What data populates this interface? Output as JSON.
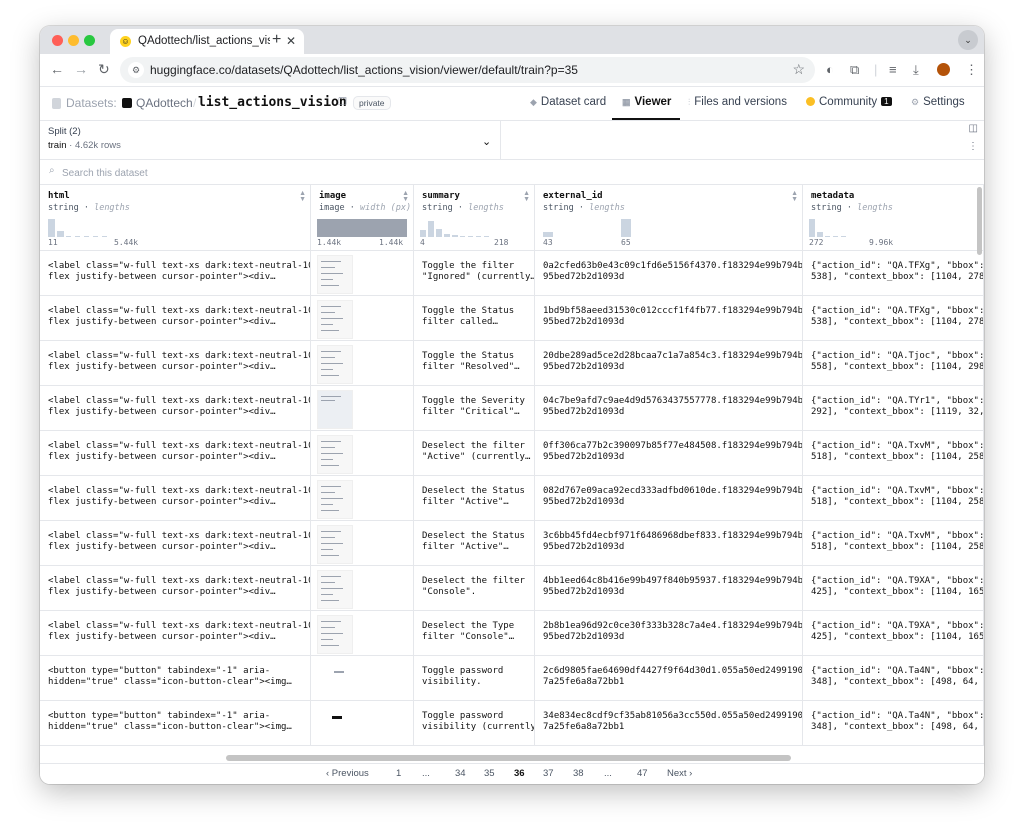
{
  "browser": {
    "tab_title": "QAdottech/list_actions_visio",
    "url": "huggingface.co/datasets/QAdottech/list_actions_vision/viewer/default/train?p=35"
  },
  "header": {
    "breadcrumb_prefix": "Datasets:",
    "org": "QAdottech",
    "separator": "/",
    "repo": "list_actions_vision",
    "badge": "private",
    "tabs": {
      "dataset_card": "Dataset card",
      "viewer": "Viewer",
      "files": "Files and versions",
      "community": "Community",
      "community_count": "1",
      "settings": "Settings"
    }
  },
  "split": {
    "label": "Split (2)",
    "name": "train",
    "rows": "4.62k rows"
  },
  "search": {
    "placeholder": "Search this dataset"
  },
  "columns": [
    {
      "name": "html",
      "type": "string",
      "stat": "lengths",
      "min": "11",
      "max": "5.44k"
    },
    {
      "name": "image",
      "type": "image",
      "stat": "width (px)",
      "min": "1.44k",
      "max": "1.44k"
    },
    {
      "name": "summary",
      "type": "string",
      "stat": "lengths",
      "min": "4",
      "max": "218"
    },
    {
      "name": "external_id",
      "type": "string",
      "stat": "lengths",
      "min": "43",
      "max": "65"
    },
    {
      "name": "metadata",
      "type": "string",
      "stat": "lengths",
      "min": "272",
      "max": "9.96k"
    }
  ],
  "rows": [
    {
      "html": "<label class=\"w-full text-xs dark:text-neutral-100\nflex justify-between cursor-pointer\"><div…",
      "summary": "Toggle the filter\n\"Ignored\" (currently…",
      "external_id": "0a2cfed63b0e43c09c1fd6e5156f4370.f183294e99b794b90\n95bed72b2d1093d",
      "metadata": "{\"action_id\": \"QA.TFXg\", \"bbox\": [1104, 2\n538], \"context_bbox\": [1104, 278, 1421, 9"
    },
    {
      "html": "<label class=\"w-full text-xs dark:text-neutral-100\nflex justify-between cursor-pointer\"><div…",
      "summary": "Toggle the Status\nfilter called…",
      "external_id": "1bd9bf58aeed31530c012cccf1f4fb77.f183294e99b794b90\n95bed72b2d1093d",
      "metadata": "{\"action_id\": \"QA.TFXg\", \"bbox\": [1104, 2\n538], \"context_bbox\": [1104, 278, 1421, 9"
    },
    {
      "html": "<label class=\"w-full text-xs dark:text-neutral-100\nflex justify-between cursor-pointer\"><div…",
      "summary": "Toggle the Status\nfilter \"Resolved\"…",
      "external_id": "20dbe289ad5ce2d28bcaa7c1a7a854c3.f183294e99b794b90\n95bed72b2d1093d",
      "metadata": "{\"action_id\": \"QA.Tjoc\", \"bbox\": [1104, 2\n558], \"context_bbox\": [1104, 298, 1421, 9"
    },
    {
      "html": "<label class=\"w-full text-xs dark:text-neutral-100\nflex justify-between cursor-pointer\"><div…",
      "summary": "Toggle the Severity\nfilter \"Critical\"…",
      "external_id": "04c7be9afd7c9ae4d9d5763437557778.f183294e99b794b90\n95bed72b2d1093d",
      "metadata": "{\"action_id\": \"QA.TYr1\", \"bbox\": [1119, 2\n292], \"context_bbox\": [1119, 32, 1421, 9"
    },
    {
      "html": "<label class=\"w-full text-xs dark:text-neutral-100\nflex justify-between cursor-pointer\"><div…",
      "summary": "Deselect the filter\n\"Active\" (currently…",
      "external_id": "0ff306ca77b2c390097b85f77e484508.f183294e99b794b90\n95bed72b2d1093d",
      "metadata": "{\"action_id\": \"QA.TxvM\", \"bbox\": [1104, 2\n518], \"context_bbox\": [1104, 258, 1421, 9"
    },
    {
      "html": "<label class=\"w-full text-xs dark:text-neutral-100\nflex justify-between cursor-pointer\"><div…",
      "summary": "Deselect the Status\nfilter \"Active\"…",
      "external_id": "082d767e09aca92ecd333adfbd0610de.f183294e99b794b90\n95bed72b2d1093d",
      "metadata": "{\"action_id\": \"QA.TxvM\", \"bbox\": [1104, 2\n518], \"context_bbox\": [1104, 258, 1421, 9"
    },
    {
      "html": "<label class=\"w-full text-xs dark:text-neutral-100\nflex justify-between cursor-pointer\"><div…",
      "summary": "Deselect the Status\nfilter \"Active\"…",
      "external_id": "3c6bb45fd4ecbf971f6486968dbef833.f183294e99b794b90\n95bed72b2d1093d",
      "metadata": "{\"action_id\": \"QA.TxvM\", \"bbox\": [1104, 2\n518], \"context_bbox\": [1104, 258, 1421, 9"
    },
    {
      "html": "<label class=\"w-full text-xs dark:text-neutral-100\nflex justify-between cursor-pointer\"><div…",
      "summary": "Deselect the filter\n\"Console\".",
      "external_id": "4bb1eed64c8b416e99b497f840b95937.f183294e99b794b90\n95bed72b2d1093d",
      "metadata": "{\"action_id\": \"QA.T9XA\", \"bbox\": [1104, 1\n425], \"context_bbox\": [1104, 165, 1421, 9"
    },
    {
      "html": "<label class=\"w-full text-xs dark:text-neutral-100\nflex justify-between cursor-pointer\"><div…",
      "summary": "Deselect the Type\nfilter \"Console\"…",
      "external_id": "2b8b1ea96d92c0ce30f333b328c7a4e4.f183294e99b794b90\n95bed72b2d1093d",
      "metadata": "{\"action_id\": \"QA.T9XA\", \"bbox\": [1104, 1\n425], \"context_bbox\": [1104, 165, 1421, 9"
    },
    {
      "html": "<button type=\"button\" tabindex=\"-1\" aria-\nhidden=\"true\" class=\"icon-button-clear\"><img…",
      "summary": "Toggle password\nvisibility.",
      "external_id": "2c6d9805fae64690df4427f9f64d30d1.055a50ed2499190c7\n7a25fe6a8a72bb1",
      "metadata": "{\"action_id\": \"QA.Ta4N\", \"bbox\": [498, 64\n348], \"context_bbox\": [498, 64, 922, 348]"
    },
    {
      "html": "<button type=\"button\" tabindex=\"-1\" aria-\nhidden=\"true\" class=\"icon-button-clear\"><img…",
      "summary": "Toggle password\nvisibility (currently…",
      "external_id": "34e834ec8cdf9cf35ab81056a3cc550d.055a50ed2499190c7\n7a25fe6a8a72bb1",
      "metadata": "{\"action_id\": \"QA.Ta4N\", \"bbox\": [498, 64\n348], \"context_bbox\": [498, 64, 922, 348]"
    }
  ],
  "pagination": {
    "prev": "‹ Previous",
    "next": "Next ›",
    "pages": [
      "1",
      "...",
      "34",
      "35",
      "36",
      "37",
      "38",
      "...",
      "47"
    ],
    "current": "36"
  }
}
